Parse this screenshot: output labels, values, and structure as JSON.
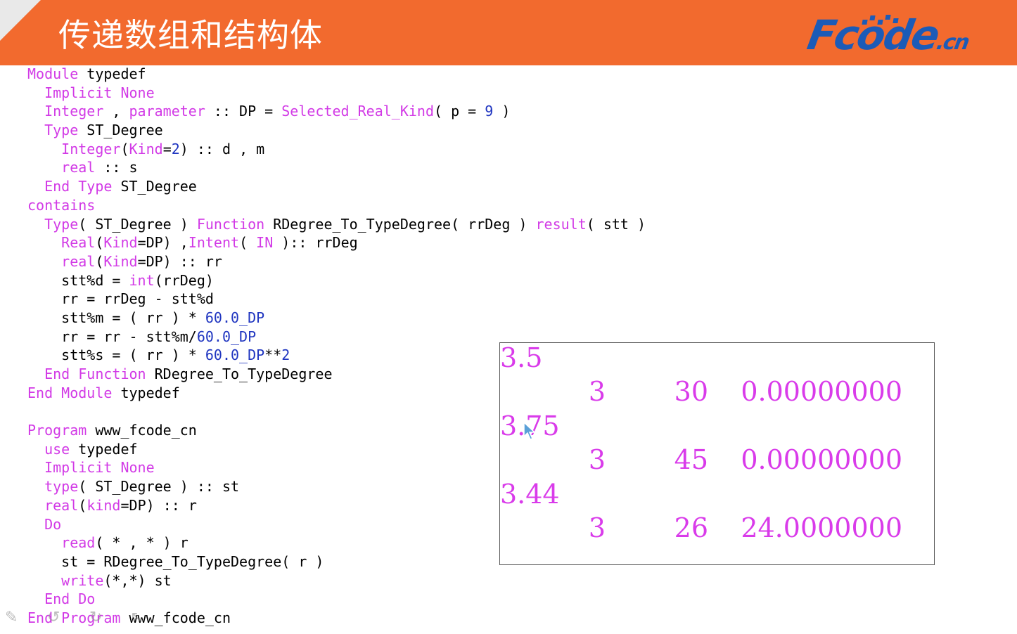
{
  "header": {
    "title": "传递数组和结构体",
    "logo_main": "Fcode",
    "logo_suffix": ".cn",
    "accent": "#f26a2e",
    "logo_color": "#1c5bb7"
  },
  "code_lines": [
    [
      [
        "k",
        "Module"
      ],
      [
        "t",
        " typedef"
      ]
    ],
    [
      [
        "t",
        "  "
      ],
      [
        "k",
        "Implicit None"
      ]
    ],
    [
      [
        "t",
        "  "
      ],
      [
        "k",
        "Integer"
      ],
      [
        "t",
        " , "
      ],
      [
        "k",
        "parameter"
      ],
      [
        "t",
        " :: DP = "
      ],
      [
        "k",
        "Selected_Real_Kind"
      ],
      [
        "t",
        "( p = "
      ],
      [
        "n",
        "9"
      ],
      [
        "t",
        " )"
      ]
    ],
    [
      [
        "t",
        "  "
      ],
      [
        "k",
        "Type"
      ],
      [
        "t",
        " ST_Degree"
      ]
    ],
    [
      [
        "t",
        "    "
      ],
      [
        "k",
        "Integer"
      ],
      [
        "t",
        "("
      ],
      [
        "k",
        "Kind"
      ],
      [
        "t",
        "="
      ],
      [
        "n",
        "2"
      ],
      [
        "t",
        ") :: d , m"
      ]
    ],
    [
      [
        "t",
        "    "
      ],
      [
        "k",
        "real"
      ],
      [
        "t",
        " :: s"
      ]
    ],
    [
      [
        "t",
        "  "
      ],
      [
        "k",
        "End Type"
      ],
      [
        "t",
        " ST_Degree"
      ]
    ],
    [
      [
        "k",
        "contains"
      ]
    ],
    [
      [
        "t",
        "  "
      ],
      [
        "k",
        "Type"
      ],
      [
        "t",
        "( ST_Degree ) "
      ],
      [
        "k",
        "Function"
      ],
      [
        "t",
        " RDegree_To_TypeDegree( rrDeg ) "
      ],
      [
        "k",
        "result"
      ],
      [
        "t",
        "( stt )"
      ]
    ],
    [
      [
        "t",
        "    "
      ],
      [
        "k",
        "Real"
      ],
      [
        "t",
        "("
      ],
      [
        "k",
        "Kind"
      ],
      [
        "t",
        "=DP) ,"
      ],
      [
        "k",
        "Intent"
      ],
      [
        "t",
        "( "
      ],
      [
        "k",
        "IN"
      ],
      [
        "t",
        " ):: rrDeg"
      ]
    ],
    [
      [
        "t",
        "    "
      ],
      [
        "k",
        "real"
      ],
      [
        "t",
        "("
      ],
      [
        "k",
        "Kind"
      ],
      [
        "t",
        "=DP) :: rr"
      ]
    ],
    [
      [
        "t",
        "    stt%d = "
      ],
      [
        "k",
        "int"
      ],
      [
        "t",
        "(rrDeg)"
      ]
    ],
    [
      [
        "t",
        "    rr = rrDeg - stt%d"
      ]
    ],
    [
      [
        "t",
        "    stt%m = ( rr ) * "
      ],
      [
        "n",
        "60.0_DP"
      ]
    ],
    [
      [
        "t",
        "    rr = rr - stt%m/"
      ],
      [
        "n",
        "60.0_DP"
      ]
    ],
    [
      [
        "t",
        "    stt%s = ( rr ) * "
      ],
      [
        "n",
        "60.0_DP"
      ],
      [
        "t",
        "**"
      ],
      [
        "n",
        "2"
      ]
    ],
    [
      [
        "t",
        "  "
      ],
      [
        "k",
        "End Function"
      ],
      [
        "t",
        " RDegree_To_TypeDegree"
      ]
    ],
    [
      [
        "k",
        "End Module"
      ],
      [
        "t",
        " typedef"
      ]
    ],
    [
      [
        "t",
        ""
      ]
    ],
    [
      [
        "k",
        "Program"
      ],
      [
        "t",
        " www_fcode_cn"
      ]
    ],
    [
      [
        "t",
        "  "
      ],
      [
        "k",
        "use"
      ],
      [
        "t",
        " typedef"
      ]
    ],
    [
      [
        "t",
        "  "
      ],
      [
        "k",
        "Implicit None"
      ]
    ],
    [
      [
        "t",
        "  "
      ],
      [
        "k",
        "type"
      ],
      [
        "t",
        "( ST_Degree ) :: st"
      ]
    ],
    [
      [
        "t",
        "  "
      ],
      [
        "k",
        "real"
      ],
      [
        "t",
        "("
      ],
      [
        "k",
        "kind"
      ],
      [
        "t",
        "=DP) :: r"
      ]
    ],
    [
      [
        "t",
        "  "
      ],
      [
        "k",
        "Do"
      ]
    ],
    [
      [
        "t",
        "    "
      ],
      [
        "k",
        "read"
      ],
      [
        "t",
        "( * , * ) r"
      ]
    ],
    [
      [
        "t",
        "    st = RDegree_To_TypeDegree( r )"
      ]
    ],
    [
      [
        "t",
        "    "
      ],
      [
        "k",
        "write"
      ],
      [
        "t",
        "(*,*) st"
      ]
    ],
    [
      [
        "t",
        "  "
      ],
      [
        "k",
        "End Do"
      ]
    ],
    [
      [
        "k",
        "End Program"
      ],
      [
        "t",
        " www_fcode_cn"
      ]
    ]
  ],
  "console": {
    "text_color": "#d93bea",
    "runs": [
      {
        "input": "3.5",
        "d": "3",
        "m": "30",
        "s": "0.00000000"
      },
      {
        "input": "3.75",
        "d": "3",
        "m": "45",
        "s": "0.00000000"
      },
      {
        "input": "3.44",
        "d": "3",
        "m": "26",
        "s": "24.0000000"
      }
    ]
  },
  "toolbar_icons": [
    "pen-icon",
    "undo-icon",
    "redo-icon",
    "pointer-icon"
  ]
}
